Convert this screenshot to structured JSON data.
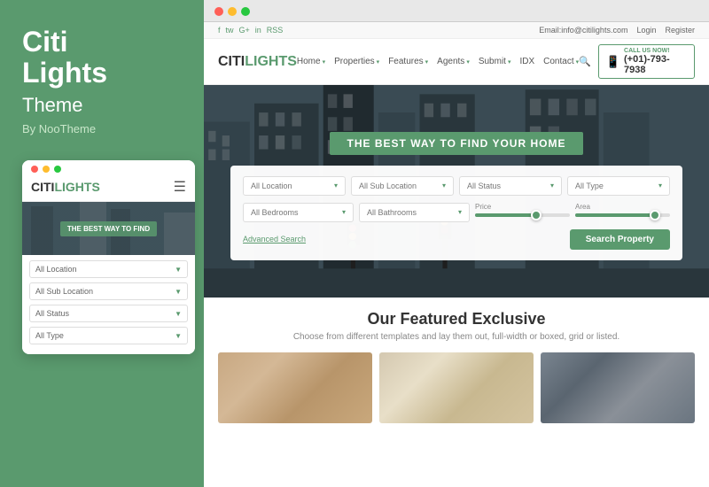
{
  "brand": {
    "title": "Citi Lights",
    "title_line1": "Citi",
    "title_line2": "Lights",
    "subtitle": "Theme",
    "by": "By NooTheme"
  },
  "mobile": {
    "logo_text": "CITI",
    "logo_accent": "LIGHTS",
    "hero_text": "THE BEST WAY TO FIND",
    "dropdowns": [
      {
        "label": "All Location"
      },
      {
        "label": "All Sub Location"
      },
      {
        "label": "All Status"
      },
      {
        "label": "All Type"
      }
    ]
  },
  "topbar": {
    "email": "Email:info@citilights.com",
    "login": "Login",
    "register": "Register",
    "social": [
      "f",
      "tw",
      "G+",
      "in",
      "RSS"
    ]
  },
  "header": {
    "logo_text": "CITI",
    "logo_accent": "LIGHTS",
    "nav_items": [
      "Home",
      "Properties",
      "Features",
      "Agents",
      "Submit",
      "IDX",
      "Contact"
    ],
    "phone_label": "CALL US NOW!",
    "phone_number": "(+01)-793-7938"
  },
  "hero": {
    "tagline": "THE BEST WAY TO FIND YOUR HOME",
    "search_button": "Search Property",
    "advanced_search": "Advanced Search",
    "filters": {
      "row1": [
        "All Location",
        "All Sub Location",
        "All Status",
        "All Type"
      ],
      "row2_left": [
        "All Bedrooms",
        "All Bathrooms"
      ],
      "price_label": "Price",
      "area_label": "Area"
    }
  },
  "featured": {
    "title": "Our Featured Exclusive",
    "subtitle": "Choose from different templates and lay them out, full-width or boxed, grid or listed."
  },
  "colors": {
    "accent": "#5a9a6e",
    "text_dark": "#333333",
    "text_muted": "#888888"
  }
}
